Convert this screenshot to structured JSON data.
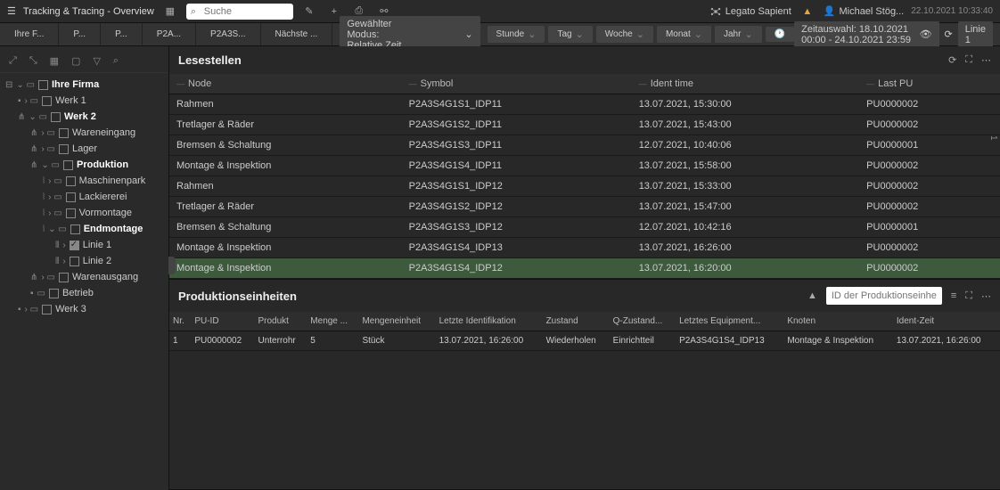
{
  "header": {
    "title": "Tracking & Tracing - Overview",
    "search_placeholder": "Suche",
    "logo_text": "Legato Sapient",
    "user_name": "Michael Stög...",
    "datetime": "22.10.2021 10:33:40"
  },
  "breadcrumb": {
    "items": [
      "Ihre F...",
      "P...",
      "P...",
      "P2A...",
      "P2A3S...",
      "Nächste ..."
    ],
    "mode_label": "Gewählter Modus: Relative Zeit",
    "time_buttons": [
      "Stunde",
      "Tag",
      "Woche",
      "Monat",
      "Jahr"
    ],
    "timerange": "Zeitauswahl: 18.10.2021 00:00 - 24.10.2021 23:59",
    "line_label": "Linie 1"
  },
  "tree": [
    {
      "indent": 0,
      "pre": "⌄ ▭",
      "cb": false,
      "lbl": "Ihre Firma",
      "bold": true
    },
    {
      "indent": 1,
      "pre": "› ▭",
      "cb": false,
      "lbl": "Werk 1"
    },
    {
      "indent": 1,
      "pre": "⌄ ▭",
      "cb": false,
      "lbl": "Werk 2",
      "bold": true
    },
    {
      "indent": 2,
      "pre": "› ▭",
      "cb": false,
      "lbl": "Wareneingang"
    },
    {
      "indent": 2,
      "pre": "› ▭",
      "cb": false,
      "lbl": "Lager"
    },
    {
      "indent": 2,
      "pre": "⌄ ▭",
      "cb": false,
      "lbl": "Produktion",
      "bold": true
    },
    {
      "indent": 3,
      "pre": "› ▭",
      "cb": false,
      "lbl": "Maschinenpark"
    },
    {
      "indent": 3,
      "pre": "› ▭",
      "cb": false,
      "lbl": "Lackiererei"
    },
    {
      "indent": 3,
      "pre": "› ▭",
      "cb": false,
      "lbl": "Vormontage"
    },
    {
      "indent": 3,
      "pre": "⌄ ▭",
      "cb": false,
      "lbl": "Endmontage",
      "bold": true
    },
    {
      "indent": 4,
      "pre": "›",
      "cb": true,
      "lbl": "Linie 1"
    },
    {
      "indent": 4,
      "pre": "›",
      "cb": false,
      "lbl": "Linie 2"
    },
    {
      "indent": 2,
      "pre": "› ▭",
      "cb": false,
      "lbl": "Warenausgang"
    },
    {
      "indent": 2,
      "pre": "▭",
      "cb": false,
      "lbl": "Betrieb"
    },
    {
      "indent": 1,
      "pre": "› ▭",
      "cb": false,
      "lbl": "Werk 3"
    }
  ],
  "panel1": {
    "title": "Lesestellen",
    "columns": [
      "Node",
      "Symbol",
      "Ident time",
      "Last PU"
    ],
    "rows": [
      {
        "node": "Rahmen",
        "symbol": "P2A3S4G1S1_IDP11",
        "time": "13.07.2021, 15:30:00",
        "pu": "PU0000002"
      },
      {
        "node": "Tretlager & Räder",
        "symbol": "P2A3S4G1S2_IDP11",
        "time": "13.07.2021, 15:43:00",
        "pu": "PU0000002"
      },
      {
        "node": "Bremsen & Schaltung",
        "symbol": "P2A3S4G1S3_IDP11",
        "time": "12.07.2021, 10:40:06",
        "pu": "PU0000001"
      },
      {
        "node": "Montage & Inspektion",
        "symbol": "P2A3S4G1S4_IDP11",
        "time": "13.07.2021, 15:58:00",
        "pu": "PU0000002"
      },
      {
        "node": "Rahmen",
        "symbol": "P2A3S4G1S1_IDP12",
        "time": "13.07.2021, 15:33:00",
        "pu": "PU0000002"
      },
      {
        "node": "Tretlager & Räder",
        "symbol": "P2A3S4G1S2_IDP12",
        "time": "13.07.2021, 15:47:00",
        "pu": "PU0000002"
      },
      {
        "node": "Bremsen & Schaltung",
        "symbol": "P2A3S4G1S3_IDP12",
        "time": "12.07.2021, 10:42:16",
        "pu": "PU0000001"
      },
      {
        "node": "Montage & Inspektion",
        "symbol": "P2A3S4G1S4_IDP13",
        "time": "13.07.2021, 16:26:00",
        "pu": "PU0000002"
      },
      {
        "node": "Montage & Inspektion",
        "symbol": "P2A3S4G1S4_IDP12",
        "time": "13.07.2021, 16:20:00",
        "pu": "PU0000002",
        "hl": true
      }
    ]
  },
  "panel2": {
    "title": "Produktionseinheiten",
    "search_placeholder": "ID der Produktionseinhei...",
    "columns": [
      "Nr.",
      "PU-ID",
      "Produkt",
      "Menge ...",
      "Mengeneinheit",
      "Letzte Identifikation",
      "Zustand",
      "Q-Zustand...",
      "Letztes Equipment...",
      "Knoten",
      "Ident-Zeit"
    ],
    "rows": [
      {
        "nr": "1",
        "puid": "PU0000002",
        "produkt": "Unterrohr",
        "menge": "5",
        "einheit": "Stück",
        "letzte": "13.07.2021, 16:26:00",
        "zustand": "Wiederholen",
        "qz": "Einrichtteil",
        "equip": "P2A3S4G1S4_IDP13",
        "knoten": "Montage & Inspektion",
        "ident": "13.07.2021, 16:26:00"
      }
    ]
  },
  "side_num": "1"
}
